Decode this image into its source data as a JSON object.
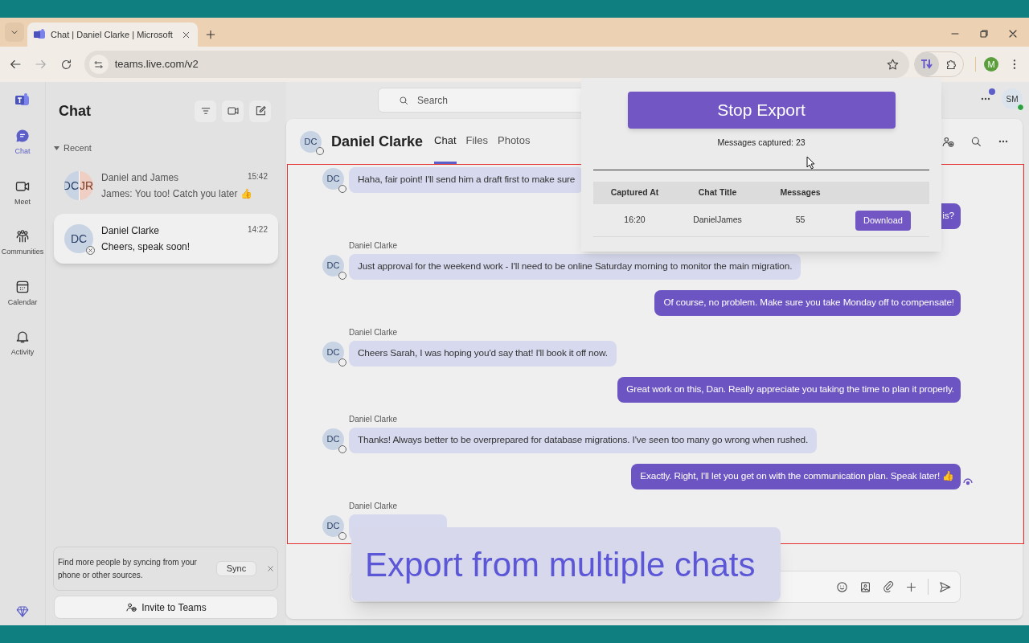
{
  "browser": {
    "tab_title": "Chat | Daniel Clarke | Microsoft",
    "url": "teams.live.com/v2",
    "profile_initial": "M"
  },
  "topbar": {
    "search_placeholder": "Search",
    "user_initials": "SM"
  },
  "rail": [
    {
      "kind": "chat",
      "label": "Chat",
      "selected": true
    },
    {
      "kind": "meet",
      "label": "Meet",
      "selected": false
    },
    {
      "kind": "communities",
      "label": "Communities",
      "selected": false
    },
    {
      "kind": "calendar",
      "label": "Calendar",
      "selected": false
    },
    {
      "kind": "activity",
      "label": "Activity",
      "selected": false
    }
  ],
  "chat_list": {
    "title": "Chat",
    "section": "Recent",
    "items": [
      {
        "initials": [
          "DC",
          "JR"
        ],
        "name": "Daniel and James",
        "time": "15:42",
        "preview": "James: You too! Catch you later 👍",
        "selected": false
      },
      {
        "initials": [
          "DC"
        ],
        "name": "Daniel Clarke",
        "time": "14:22",
        "preview": "Cheers, speak soon!",
        "selected": true
      }
    ]
  },
  "sync_card": {
    "text": "Find more people by syncing from your phone or other sources.",
    "button": "Sync"
  },
  "invite_button": "Invite to Teams",
  "conversation": {
    "initials": "DC",
    "name": "Daniel Clarke",
    "tabs": [
      {
        "label": "Chat",
        "selected": true
      },
      {
        "label": "Files",
        "selected": false
      },
      {
        "label": "Photos",
        "selected": false
      }
    ]
  },
  "messages": [
    {
      "kind": "incoming",
      "avatar": "DC",
      "text": "Haha, fair point! I'll send him a draft first to make sure"
    },
    {
      "kind": "outgoing",
      "text": "is?"
    },
    {
      "kind": "incoming",
      "sender": "Daniel Clarke",
      "avatar": "DC",
      "text": "Just approval for the weekend work - I'll need to be online Saturday morning to monitor the main migration."
    },
    {
      "kind": "outgoing",
      "text": "Of course, no problem. Make sure you take Monday off to compensate!"
    },
    {
      "kind": "incoming",
      "sender": "Daniel Clarke",
      "avatar": "DC",
      "text": "Cheers Sarah, I was hoping you'd say that! I'll book it off now."
    },
    {
      "kind": "outgoing",
      "text": "Great work on this, Dan. Really appreciate you taking the time to plan it properly."
    },
    {
      "kind": "incoming",
      "sender": "Daniel Clarke",
      "avatar": "DC",
      "text": "Thanks! Always better to be overprepared for database migrations. I've seen too many go wrong when rushed."
    },
    {
      "kind": "outgoing",
      "text": "Exactly. Right, I'll let you get on with the communication plan. Speak later! 👍",
      "seen": true
    },
    {
      "kind": "incoming",
      "sender": "Daniel Clarke",
      "avatar": "DC"
    }
  ],
  "export_popup": {
    "button": "Stop Export",
    "status": "Messages captured: 23",
    "columns": [
      "Captured At",
      "Chat Title",
      "Messages"
    ],
    "rows": [
      {
        "captured_at": "16:20",
        "chat_title": "DanielJames",
        "messages": "55",
        "action": "Download"
      }
    ]
  },
  "caption": "Export from multiple chats"
}
